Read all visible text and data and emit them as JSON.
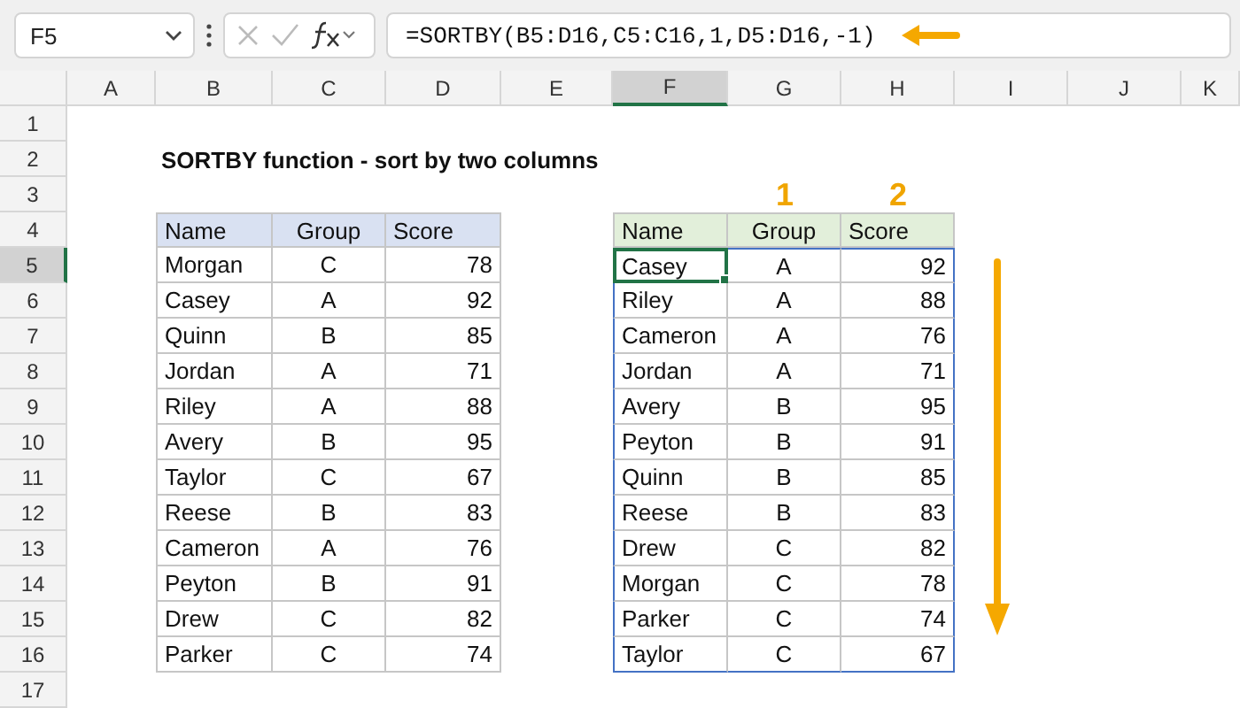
{
  "name_box": {
    "value": "F5"
  },
  "formula_bar": {
    "value": "=SORTBY(B5:D16,C5:C16,1,D5:D16,-1)"
  },
  "columns": [
    {
      "label": "A",
      "selected": false
    },
    {
      "label": "B",
      "selected": false
    },
    {
      "label": "C",
      "selected": false
    },
    {
      "label": "D",
      "selected": false
    },
    {
      "label": "E",
      "selected": false
    },
    {
      "label": "F",
      "selected": true
    },
    {
      "label": "G",
      "selected": false
    },
    {
      "label": "H",
      "selected": false
    },
    {
      "label": "I",
      "selected": false
    },
    {
      "label": "J",
      "selected": false
    },
    {
      "label": "K",
      "selected": false
    }
  ],
  "rows": [
    {
      "label": "1",
      "selected": false
    },
    {
      "label": "2",
      "selected": false
    },
    {
      "label": "3",
      "selected": false
    },
    {
      "label": "4",
      "selected": false
    },
    {
      "label": "5",
      "selected": true
    },
    {
      "label": "6",
      "selected": false
    },
    {
      "label": "7",
      "selected": false
    },
    {
      "label": "8",
      "selected": false
    },
    {
      "label": "9",
      "selected": false
    },
    {
      "label": "10",
      "selected": false
    },
    {
      "label": "11",
      "selected": false
    },
    {
      "label": "12",
      "selected": false
    },
    {
      "label": "13",
      "selected": false
    },
    {
      "label": "14",
      "selected": false
    },
    {
      "label": "15",
      "selected": false
    },
    {
      "label": "16",
      "selected": false
    },
    {
      "label": "17",
      "selected": false
    }
  ],
  "title": "SORTBY function - sort by two columns",
  "source_table": {
    "columns": [
      "Name",
      "Group",
      "Score"
    ],
    "rows": [
      [
        "Morgan",
        "C",
        "78"
      ],
      [
        "Casey",
        "A",
        "92"
      ],
      [
        "Quinn",
        "B",
        "85"
      ],
      [
        "Jordan",
        "A",
        "71"
      ],
      [
        "Riley",
        "A",
        "88"
      ],
      [
        "Avery",
        "B",
        "95"
      ],
      [
        "Taylor",
        "C",
        "67"
      ],
      [
        "Reese",
        "B",
        "83"
      ],
      [
        "Cameron",
        "A",
        "76"
      ],
      [
        "Peyton",
        "B",
        "91"
      ],
      [
        "Drew",
        "C",
        "82"
      ],
      [
        "Parker",
        "C",
        "74"
      ]
    ]
  },
  "sort_keys": [
    "1",
    "2"
  ],
  "result_table": {
    "columns": [
      "Name",
      "Group",
      "Score"
    ],
    "rows": [
      {
        "cells": [
          "Casey",
          "A",
          "92"
        ],
        "selected": true
      },
      {
        "cells": [
          "Riley",
          "A",
          "88"
        ],
        "selected": false
      },
      {
        "cells": [
          "Cameron",
          "A",
          "76"
        ],
        "selected": false
      },
      {
        "cells": [
          "Jordan",
          "A",
          "71"
        ],
        "selected": false
      },
      {
        "cells": [
          "Avery",
          "B",
          "95"
        ],
        "selected": false
      },
      {
        "cells": [
          "Peyton",
          "B",
          "91"
        ],
        "selected": false
      },
      {
        "cells": [
          "Quinn",
          "B",
          "85"
        ],
        "selected": false
      },
      {
        "cells": [
          "Reese",
          "B",
          "83"
        ],
        "selected": false
      },
      {
        "cells": [
          "Drew",
          "C",
          "82"
        ],
        "selected": false
      },
      {
        "cells": [
          "Morgan",
          "C",
          "78"
        ],
        "selected": false
      },
      {
        "cells": [
          "Parker",
          "C",
          "74"
        ],
        "selected": false
      },
      {
        "cells": [
          "Taylor",
          "C",
          "67"
        ],
        "selected": false
      }
    ]
  }
}
